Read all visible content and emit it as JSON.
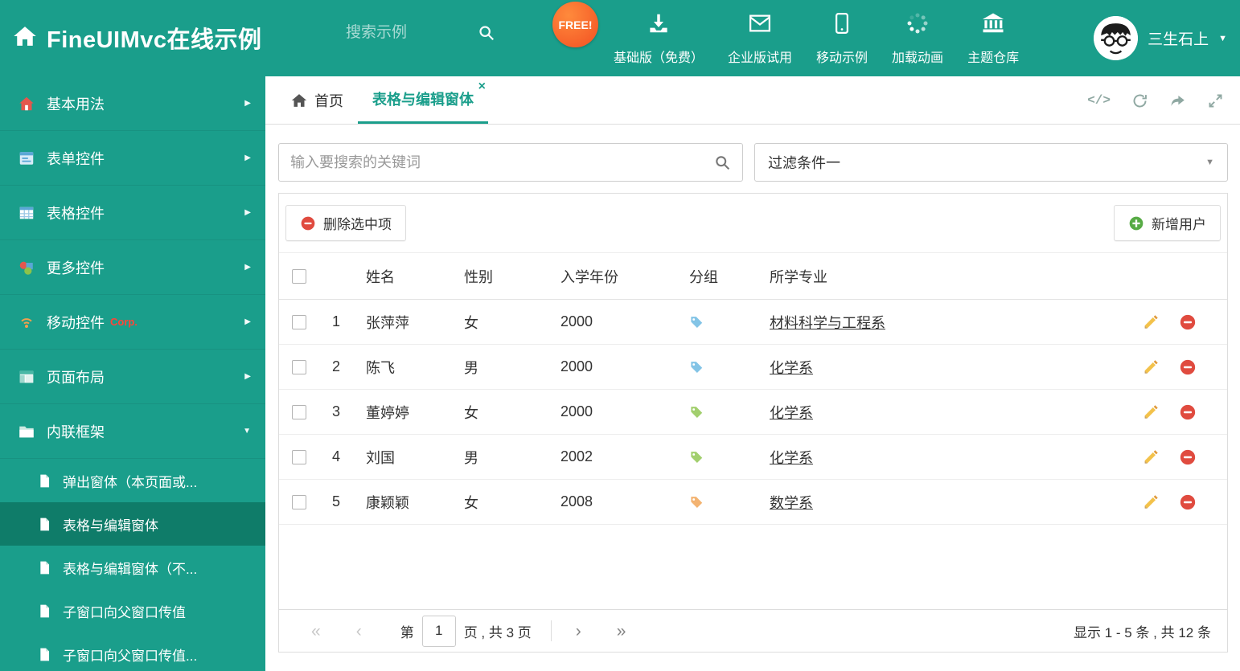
{
  "header": {
    "title": "FineUIMvc在线示例",
    "search_placeholder": "搜索示例",
    "free_badge": "FREE!",
    "nav": [
      {
        "label": "基础版（免费）",
        "icon": "download-icon"
      },
      {
        "label": "企业版试用",
        "icon": "envelope-icon"
      },
      {
        "label": "移动示例",
        "icon": "mobile-icon"
      },
      {
        "label": "加载动画",
        "icon": "spinner-icon"
      },
      {
        "label": "主题仓库",
        "icon": "bank-icon"
      }
    ],
    "user_name": "三生石上"
  },
  "sidebar": {
    "items": [
      {
        "label": "基本用法",
        "icon": "home-icon"
      },
      {
        "label": "表单控件",
        "icon": "form-icon"
      },
      {
        "label": "表格控件",
        "icon": "table-icon"
      },
      {
        "label": "更多控件",
        "icon": "widgets-icon"
      },
      {
        "label": "移动控件",
        "badge": "Corp.",
        "icon": "mobile-signal-icon"
      },
      {
        "label": "页面布局",
        "icon": "layout-icon"
      },
      {
        "label": "内联框架",
        "icon": "folder-icon"
      }
    ],
    "subitems": [
      {
        "label": "弹出窗体（本页面或..."
      },
      {
        "label": "表格与编辑窗体"
      },
      {
        "label": "表格与编辑窗体（不..."
      },
      {
        "label": "子窗口向父窗口传值"
      },
      {
        "label": "子窗口向父窗口传值..."
      }
    ]
  },
  "tabs": {
    "home_label": "首页",
    "active_label": "表格与编辑窗体"
  },
  "filterbar": {
    "search_placeholder": "输入要搜索的关键词",
    "filter_value": "过滤条件一"
  },
  "toolbar": {
    "delete_label": "删除选中项",
    "add_label": "新增用户"
  },
  "table": {
    "headers": {
      "name": "姓名",
      "gender": "性别",
      "year": "入学年份",
      "group": "分组",
      "major": "所学专业"
    },
    "rows": [
      {
        "num": "1",
        "name": "张萍萍",
        "gender": "女",
        "year": "2000",
        "tag_color": "#64b5e0",
        "major": "材料科学与工程系"
      },
      {
        "num": "2",
        "name": "陈飞",
        "gender": "男",
        "year": "2000",
        "tag_color": "#64b5e0",
        "major": "化学系"
      },
      {
        "num": "3",
        "name": "董婷婷",
        "gender": "女",
        "year": "2000",
        "tag_color": "#8bc34a",
        "major": "化学系"
      },
      {
        "num": "4",
        "name": "刘国",
        "gender": "男",
        "year": "2002",
        "tag_color": "#8bc34a",
        "major": "化学系"
      },
      {
        "num": "5",
        "name": "康颖颖",
        "gender": "女",
        "year": "2008",
        "tag_color": "#f0a04e",
        "major": "数学系"
      }
    ]
  },
  "pagination": {
    "page_label": "第",
    "page_value": "1",
    "total_label": "页 , 共 3 页",
    "summary": "显示 1 - 5 条 , 共 12 条"
  },
  "icons": {
    "first": "«",
    "prev": "‹",
    "next": "›",
    "last": "»",
    "caret_down": "▼",
    "caret_right": "▶",
    "close": "×",
    "code": "</>"
  },
  "colors": {
    "theme_green": "#1a9e8b",
    "sidebar_active": "#0f7c69",
    "free_badge": "#f25022"
  }
}
